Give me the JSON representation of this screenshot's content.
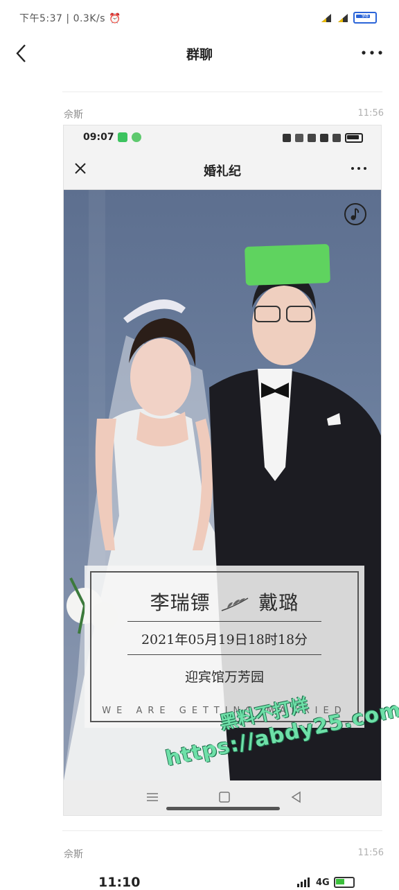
{
  "status_bar": {
    "time": "下午5:37",
    "speed": "0.3K/s",
    "battery": "98"
  },
  "header": {
    "title": "群聊"
  },
  "messages": [
    {
      "sender": "佘斯",
      "time": "11:56"
    },
    {
      "sender": "佘斯",
      "time": "11:56"
    }
  ],
  "embedded_screenshot": {
    "status_time": "09:07",
    "title": "婚礼纪",
    "invitation": {
      "groom_name": "李瑞镖",
      "bride_name": "戴璐",
      "datetime": "2021年05月19日18时18分",
      "venue": "迎宾馆万芳园",
      "tagline": "WE ARE GETTING MARRIED"
    }
  },
  "watermark": {
    "line1": "黑料不打烊",
    "line2": "https://abdy25.com"
  },
  "next_message_preview": {
    "status_time": "11:10",
    "network": "4G"
  }
}
